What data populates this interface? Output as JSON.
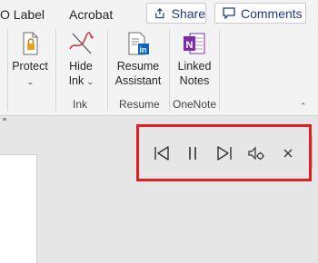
{
  "tabs": [
    "O Label",
    "Acrobat"
  ],
  "top_buttons": {
    "share": "Share",
    "comments": "Comments"
  },
  "commands": {
    "protect": "Protect",
    "hide_ink": [
      "Hide",
      "Ink"
    ],
    "resume_assistant": [
      "Resume",
      "Assistant"
    ],
    "linked_notes": [
      "Linked",
      "Notes"
    ]
  },
  "groups": {
    "ink": "Ink",
    "resume": "Resume",
    "onenote": "OneNote"
  },
  "read_aloud_toolbar": {
    "controls": [
      "previous-icon",
      "pause-icon",
      "next-icon",
      "settings-icon",
      "close-icon"
    ],
    "highlight_color": "#e02020"
  },
  "colors": {
    "accent": "#1e3a8a",
    "onenote": "#7b2fa6",
    "linkedin": "#0a66c2"
  }
}
